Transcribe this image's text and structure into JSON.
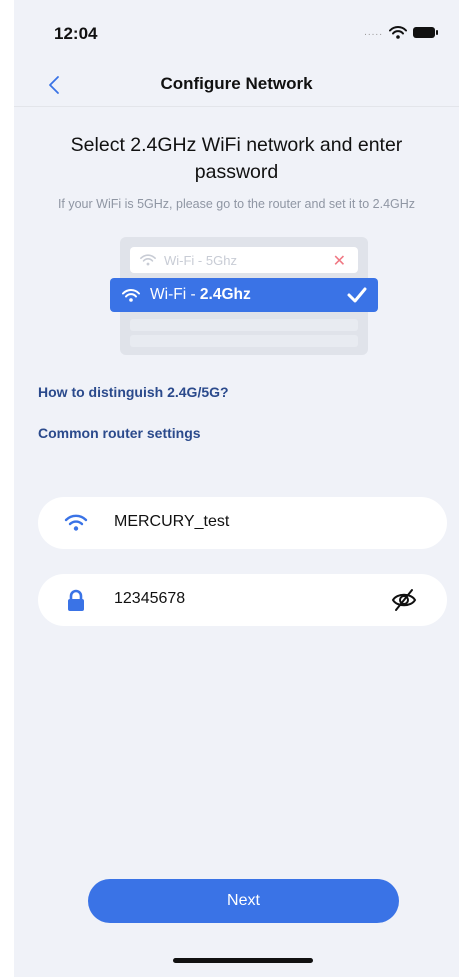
{
  "status_bar": {
    "time": "12:04",
    "signal_dots": "....."
  },
  "nav": {
    "title": "Configure Network"
  },
  "main": {
    "title": "Select 2.4GHz WiFi network and enter password",
    "subtitle": "If your WiFi is 5GHz, please go to the router and set it to 2.4GHz"
  },
  "illustration": {
    "wifi_5g_label": "Wi-Fi - 5Ghz",
    "wifi_24_prefix": "Wi-Fi - ",
    "wifi_24_bold": "2.4Ghz"
  },
  "links": {
    "distinguish": "How to distinguish 2.4G/5G?",
    "router_settings": "Common router settings"
  },
  "form": {
    "ssid": "MERCURY_test",
    "password": "12345678"
  },
  "actions": {
    "next": "Next"
  },
  "colors": {
    "accent": "#3a73e6",
    "link": "#2b4a8c",
    "error": "#f07883",
    "background": "#f0f2f8"
  },
  "icons": [
    "back-chevron-icon",
    "wifi-icon",
    "lock-icon",
    "eye-off-icon",
    "check-icon",
    "close-icon"
  ]
}
